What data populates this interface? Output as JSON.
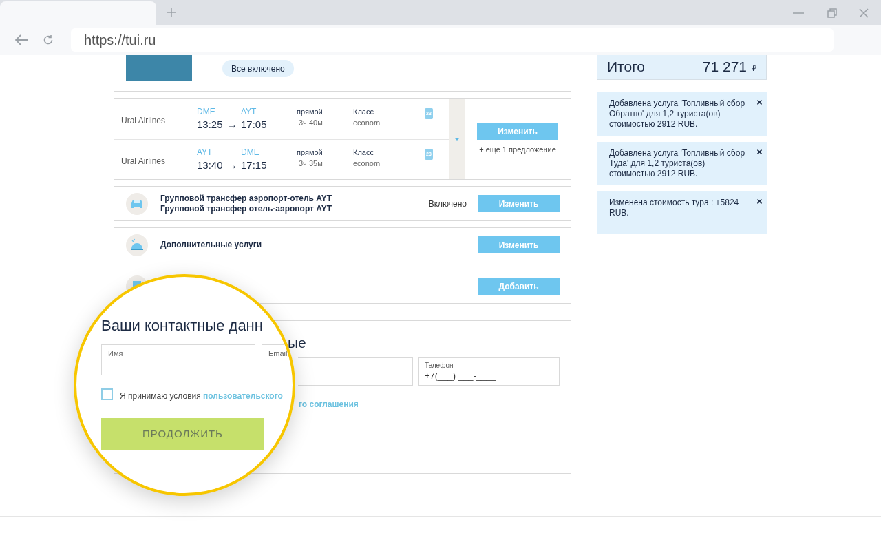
{
  "browser": {
    "url": "https://tui.ru"
  },
  "hotel": {
    "board": "Все включено"
  },
  "flights": {
    "rows": [
      {
        "airline": "Ural Airlines",
        "from": "DME",
        "to": "AYT",
        "depart": "13:25",
        "arrow": "→",
        "arrive": "17:05",
        "stops": "прямой",
        "duration": "3ч 40м",
        "class_label": "Класс",
        "class_value": "econom",
        "baggage": "23"
      },
      {
        "airline": "Ural Airlines",
        "from": "AYT",
        "to": "DME",
        "depart": "13:40",
        "arrow": "→",
        "arrive": "17:15",
        "stops": "прямой",
        "duration": "3ч 35м",
        "class_label": "Класс",
        "class_value": "econom",
        "baggage": "23"
      }
    ],
    "change_button": "Изменить",
    "more_offers": "+ еще 1 предложение"
  },
  "services": [
    {
      "kind": "transfer",
      "lines": [
        "Групповой трансфер аэропорт-отель AYT",
        "Групповой трансфер отель-аэропорт AYT"
      ],
      "status": "Включено",
      "button": "Изменить"
    },
    {
      "kind": "extras",
      "lines": [
        "Дополнительные услуги"
      ],
      "button": "Изменить"
    },
    {
      "kind": "insurance",
      "button": "Добавить"
    }
  ],
  "contact": {
    "heading_fragment": "ые",
    "phone": {
      "label": "Телефон",
      "value": "+7(___) ___-____"
    },
    "agreement_fragment": "го соглашения"
  },
  "magnifier": {
    "heading": "Ваши контактные данн",
    "fields": [
      {
        "label": "Имя"
      },
      {
        "label": "Email"
      }
    ],
    "agreement": {
      "text": "Я принимаю условия",
      "link": "пользовательского",
      "checked": false
    },
    "button": "ПРОДОЛЖИТЬ"
  },
  "summary": {
    "total_label": "Итого",
    "total_value": "71 271",
    "currency": "₽"
  },
  "notifications": [
    {
      "text": "Добавлена услуга 'Топливный сбор Обратно' для 1,2 туриста(ов) стоимостью 2912 RUB."
    },
    {
      "text": "Добавлена услуга 'Топливный сбор Туда' для 1,2 туриста(ов) стоимостью 2912 RUB."
    },
    {
      "text": "Изменена стоимость тура : +5824 RUB."
    }
  ]
}
